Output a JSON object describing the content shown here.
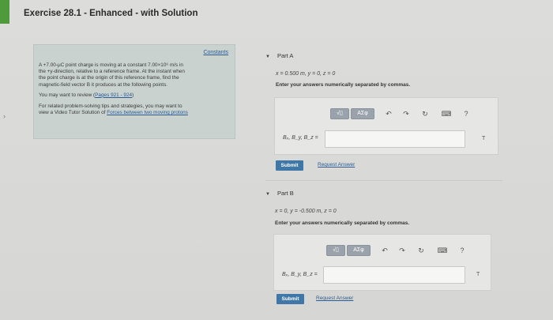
{
  "header": {
    "title": "Exercise 28.1 - Enhanced - with Solution"
  },
  "side_arrow": "›",
  "info_box": {
    "constants_label": "Constants",
    "problem_lines": [
      "A +7.00-μC point charge is moving at a constant 7.00×10⁶ m/s in",
      "the +y-direction, relative to a reference frame. At the instant when",
      "the point charge is at the origin of this reference frame, find the",
      "magnetic-field vector B it produces at the following points."
    ],
    "review_prefix": "You may want to review (",
    "review_link": "Pages 921 - 924",
    "review_suffix": ")",
    "tips_lines": [
      "For related problem-solving tips and strategies, you may want to",
      "view a Video Tutor Solution of "
    ],
    "tips_link": "Forces between two moving protons"
  },
  "parts": [
    {
      "title": "Part A",
      "given": "x = 0.500 m, y = 0, z = 0",
      "instruction": "Enter your answers numerically separated by commas.",
      "toolbar": {
        "sqrt_label": "√▯",
        "greek_label": "AΣφ"
      },
      "var_label": "Bₓ, B_y, B_z =",
      "unit": "T",
      "submit_label": "Submit",
      "request_label": "Request Answer"
    },
    {
      "title": "Part B",
      "given": "x = 0, y = -0.500 m, z = 0",
      "instruction": "Enter your answers numerically separated by commas.",
      "toolbar": {
        "sqrt_label": "√▯",
        "greek_label": "AΣφ"
      },
      "var_label": "Bₓ, B_y, B_z =",
      "unit": "T",
      "submit_label": "Submit",
      "request_label": "Request Answer"
    }
  ],
  "icons": {
    "undo": "↶",
    "redo": "↷",
    "reset": "↻",
    "keyboard": "⌨",
    "help": "?"
  },
  "colors": {
    "accent_green": "#4f9a3a",
    "submit_blue": "#3f78a8",
    "link_blue": "#2b5c92",
    "info_bg": "#c9d2cf"
  }
}
